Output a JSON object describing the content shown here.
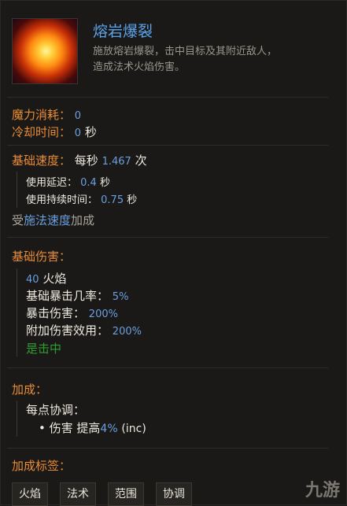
{
  "skill": {
    "name": "熔岩爆裂",
    "description_line1": "施放熔岩爆裂，击中目标及其附近敌人，",
    "description_line2": "造成法术火焰伤害。"
  },
  "cost": {
    "mana_label": "魔力消耗：",
    "mana_value": "0",
    "cooldown_label": "冷却时间：",
    "cooldown_value": "0",
    "cooldown_unit": "秒"
  },
  "speed": {
    "label": "基础速度：",
    "prefix": "每秒",
    "value": "1.467",
    "suffix": "次",
    "delay_label": "使用延迟：",
    "delay_value": "0.4",
    "delay_unit": "秒",
    "duration_label": "使用持续时间：",
    "duration_value": "0.75",
    "duration_unit": "秒",
    "affected_prefix": "受",
    "affected_link": "施法速度",
    "affected_suffix": "加成"
  },
  "damage": {
    "label": "基础伤害：",
    "amount": "40",
    "type": "火焰",
    "crit_chance_label": "基础暴击几率：",
    "crit_chance_value": "5%",
    "crit_damage_label": "暴击伤害：",
    "crit_damage_value": "200%",
    "added_effect_label": "附加伤害效用：",
    "added_effect_value": "200%",
    "on_hit": "是击中"
  },
  "scaling": {
    "label": "加成：",
    "per_point_label": "每点协调：",
    "bullet": "•",
    "stat": "伤害 提高",
    "value": "4%",
    "suffix": "(inc)"
  },
  "tags": {
    "label": "加成标签：",
    "items": [
      "火焰",
      "法术",
      "范围",
      "协调"
    ]
  },
  "watermark": "九游"
}
